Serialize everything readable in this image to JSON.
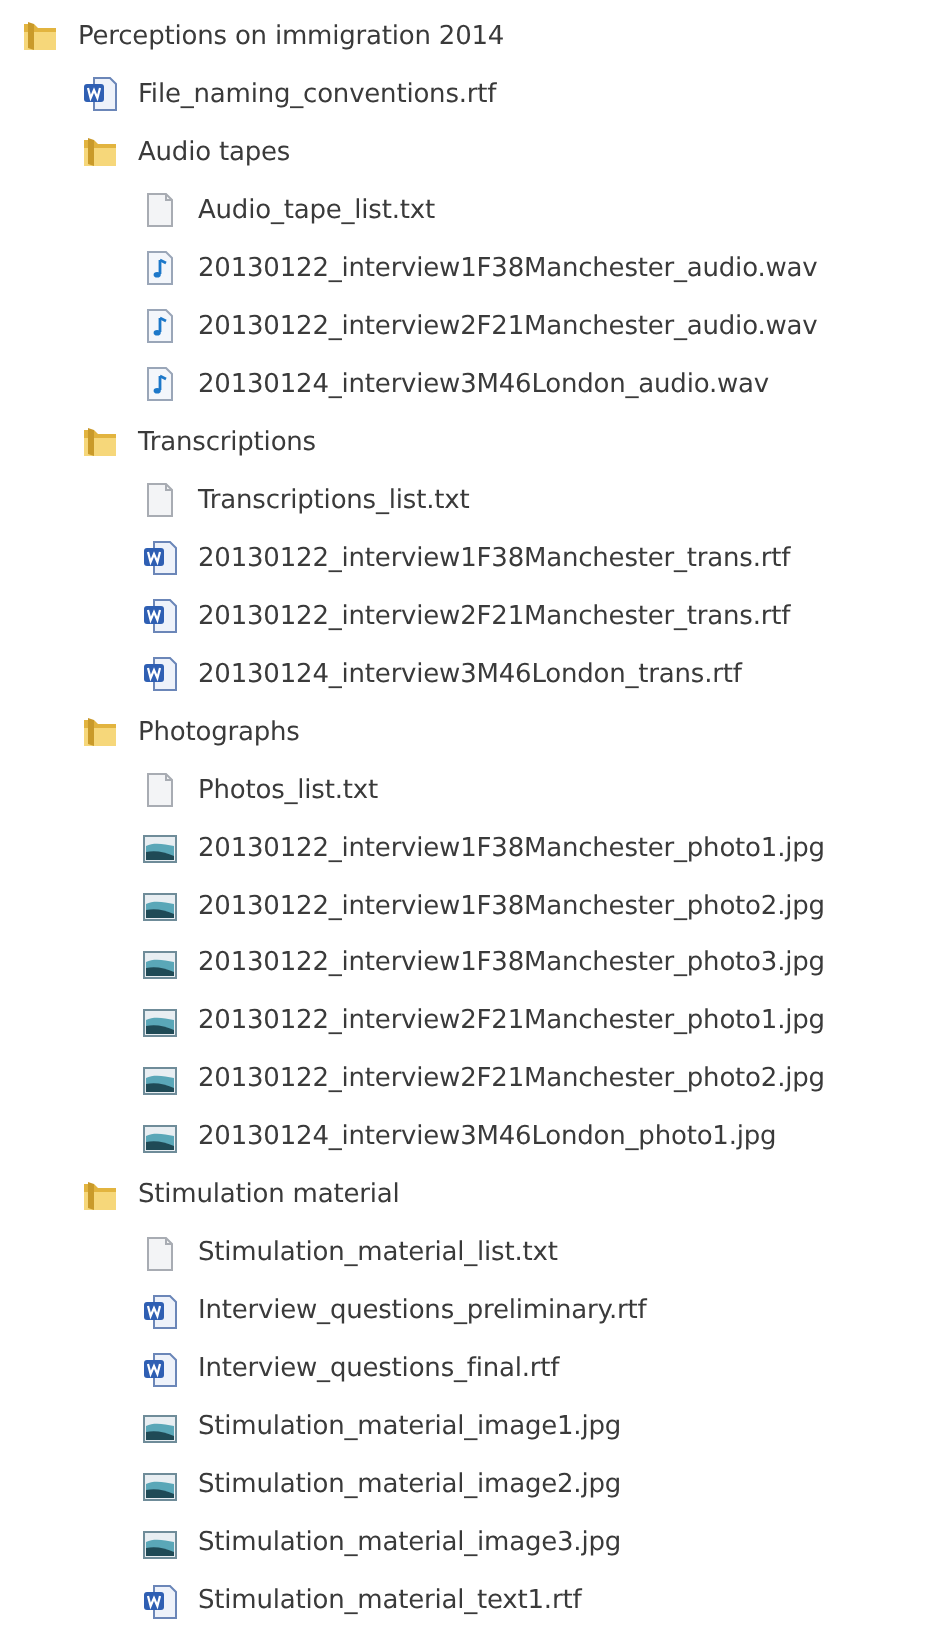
{
  "tree": [
    {
      "kind": "folder",
      "name": "Perceptions on immigration 2014",
      "children": [
        {
          "kind": "word",
          "name": "File_naming_conventions.rtf"
        },
        {
          "kind": "folder",
          "name": "Audio tapes",
          "children": [
            {
              "kind": "text",
              "name": "Audio_tape_list.txt"
            },
            {
              "kind": "audio",
              "name": "20130122_interview1F38Manchester_audio.wav"
            },
            {
              "kind": "audio",
              "name": "20130122_interview2F21Manchester_audio.wav"
            },
            {
              "kind": "audio",
              "name": "20130124_interview3M46London_audio.wav"
            }
          ]
        },
        {
          "kind": "folder",
          "name": "Transcriptions",
          "children": [
            {
              "kind": "text",
              "name": "Transcriptions_list.txt"
            },
            {
              "kind": "word",
              "name": "20130122_interview1F38Manchester_trans.rtf"
            },
            {
              "kind": "word",
              "name": "20130122_interview2F21Manchester_trans.rtf"
            },
            {
              "kind": "word",
              "name": "20130124_interview3M46London_trans.rtf"
            }
          ]
        },
        {
          "kind": "folder",
          "name": "Photographs",
          "children": [
            {
              "kind": "text",
              "name": "Photos_list.txt"
            },
            {
              "kind": "image",
              "name": "20130122_interview1F38Manchester_photo1.jpg"
            },
            {
              "kind": "image",
              "name": "20130122_interview1F38Manchester_photo2.jpg"
            },
            {
              "kind": "image",
              "name": "20130122_interview1F38Manchester_photo3.jpg"
            },
            {
              "kind": "image",
              "name": "20130122_interview2F21Manchester_photo1.jpg"
            },
            {
              "kind": "image",
              "name": "20130122_interview2F21Manchester_photo2.jpg"
            },
            {
              "kind": "image",
              "name": "20130124_interview3M46London_photo1.jpg"
            }
          ]
        },
        {
          "kind": "folder",
          "name": "Stimulation material",
          "children": [
            {
              "kind": "text",
              "name": "Stimulation_material_list.txt"
            },
            {
              "kind": "word",
              "name": "Interview_questions_preliminary.rtf"
            },
            {
              "kind": "word",
              "name": "Interview_questions_final.rtf"
            },
            {
              "kind": "image",
              "name": "Stimulation_material_image1.jpg"
            },
            {
              "kind": "image",
              "name": "Stimulation_material_image2.jpg"
            },
            {
              "kind": "image",
              "name": "Stimulation_material_image3.jpg"
            },
            {
              "kind": "word",
              "name": "Stimulation_material_text1.rtf"
            }
          ]
        }
      ]
    }
  ]
}
